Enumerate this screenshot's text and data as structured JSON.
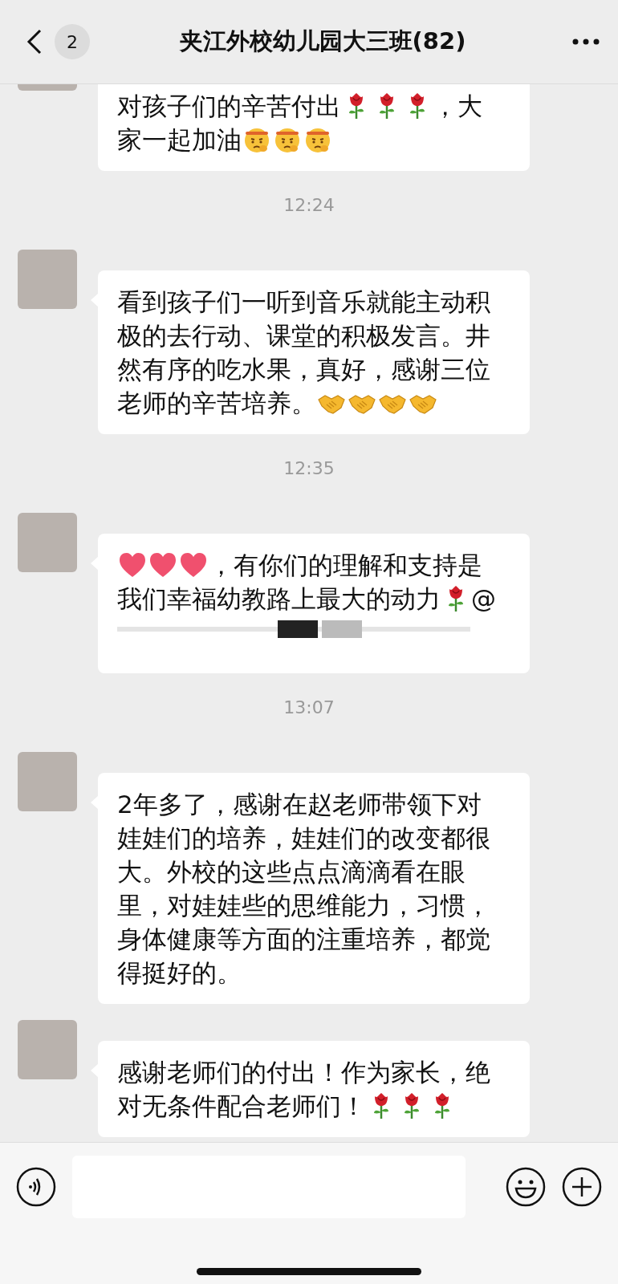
{
  "header": {
    "back_badge": "2",
    "title": "夹江外校幼儿园大三班(82)"
  },
  "messages": [
    {
      "kind": "message",
      "clipped_top": true,
      "lines": [
        [
          {
            "kind": "text",
            "text": "对孩子们的辛苦付出"
          },
          {
            "kind": "rose"
          },
          {
            "kind": "rose"
          },
          {
            "kind": "rose"
          },
          {
            "kind": "text",
            "text": "，大"
          }
        ],
        [
          {
            "kind": "text",
            "text": "家一起加油"
          },
          {
            "kind": "face"
          },
          {
            "kind": "face"
          },
          {
            "kind": "face"
          }
        ]
      ]
    },
    {
      "kind": "time",
      "text": "12:24"
    },
    {
      "kind": "message",
      "lines": [
        [
          {
            "kind": "text",
            "text": "看到孩子们一听到音乐就能主动积"
          }
        ],
        [
          {
            "kind": "text",
            "text": "极的去行动、课堂的积极发言。井"
          }
        ],
        [
          {
            "kind": "text",
            "text": "然有序的吃水果，真好，感谢三位"
          }
        ],
        [
          {
            "kind": "text",
            "text": "老师的辛苦培养。"
          },
          {
            "kind": "handshake"
          },
          {
            "kind": "handshake"
          },
          {
            "kind": "handshake"
          },
          {
            "kind": "handshake"
          }
        ]
      ]
    },
    {
      "kind": "time",
      "text": "12:35"
    },
    {
      "kind": "message",
      "redacted_line": true,
      "lines": [
        [
          {
            "kind": "heart"
          },
          {
            "kind": "heart"
          },
          {
            "kind": "heart"
          },
          {
            "kind": "text",
            "text": "，有你们的理解和支持是"
          }
        ],
        [
          {
            "kind": "text",
            "text": "我们幸福幼教路上最大的动力"
          },
          {
            "kind": "rose"
          },
          {
            "kind": "text",
            "text": "@"
          }
        ]
      ]
    },
    {
      "kind": "time",
      "text": "13:07"
    },
    {
      "kind": "message",
      "lines": [
        [
          {
            "kind": "text",
            "text": "2年多了，感谢在赵老师带领下对"
          }
        ],
        [
          {
            "kind": "text",
            "text": "娃娃们的培养，娃娃们的改变都很"
          }
        ],
        [
          {
            "kind": "text",
            "text": "大。外校的这些点点滴滴看在眼"
          }
        ],
        [
          {
            "kind": "text",
            "text": "里，对娃娃些的思维能力，习惯，"
          }
        ],
        [
          {
            "kind": "text",
            "text": "身体健康等方面的注重培养，都觉"
          }
        ],
        [
          {
            "kind": "text",
            "text": "得挺好的。"
          }
        ]
      ]
    },
    {
      "kind": "message",
      "lines": [
        [
          {
            "kind": "text",
            "text": "感谢老师们的付出！作为家长，绝"
          }
        ],
        [
          {
            "kind": "text",
            "text": "对无条件配合老师们！"
          },
          {
            "kind": "rose"
          },
          {
            "kind": "rose"
          },
          {
            "kind": "rose"
          }
        ]
      ]
    }
  ]
}
